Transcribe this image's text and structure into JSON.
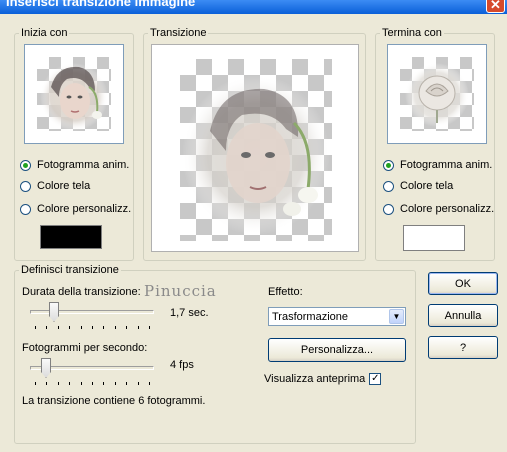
{
  "window": {
    "title": "Inserisci transizione immagine",
    "close_glyph": "✕"
  },
  "start_group": {
    "legend": "Inizia con",
    "options": [
      "Fotogramma anim.",
      "Colore tela",
      "Colore personalizz."
    ],
    "selected": 0,
    "custom_color": "#000000",
    "preview_icon": "woman-portrait-thumbnail"
  },
  "transition_group": {
    "legend": "Transizione",
    "preview_icon": "blended-portrait-preview"
  },
  "end_group": {
    "legend": "Termina con",
    "options": [
      "Fotogramma anim.",
      "Colore tela",
      "Colore personalizz."
    ],
    "selected": 0,
    "custom_color": "#ffffff",
    "preview_icon": "white-rose-thumbnail"
  },
  "define_group": {
    "legend": "Definisci transizione",
    "duration_label": "Durata della transizione:",
    "duration_value": "1,7 sec.",
    "duration_fraction": 0.17,
    "watermark": "Pinuccia",
    "fps_label": "Fotogrammi per secondo:",
    "fps_value": "4 fps",
    "fps_fraction": 0.1,
    "info_text": "La transizione contiene 6 fotogrammi.",
    "effect_label": "Effetto:",
    "effect_value": "Trasformazione",
    "customize_label": "Personalizza...",
    "preview_label": "Visualizza anteprima",
    "preview_checked": true
  },
  "buttons": {
    "ok": "OK",
    "cancel": "Annulla",
    "help": "?"
  }
}
